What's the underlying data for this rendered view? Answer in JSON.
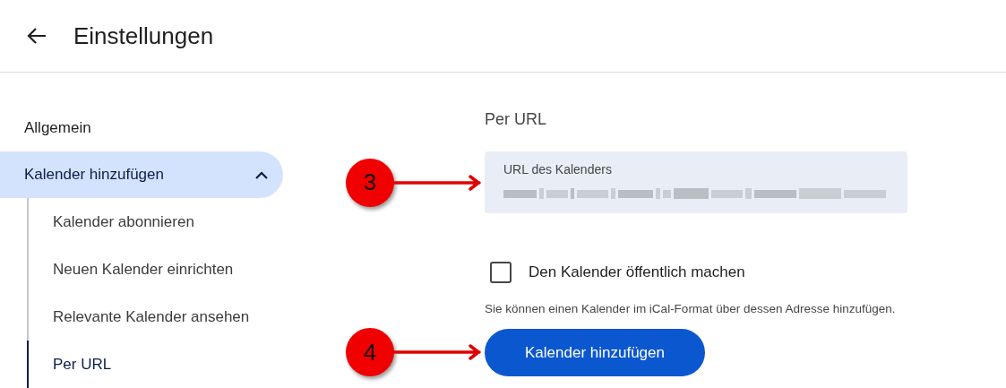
{
  "header": {
    "title": "Einstellungen"
  },
  "sidebar": {
    "items": [
      {
        "label": "Allgemein",
        "selected": false
      },
      {
        "label": "Kalender hinzufügen",
        "selected": true,
        "expanded": true,
        "children": [
          {
            "label": "Kalender abonnieren",
            "selected": false
          },
          {
            "label": "Neuen Kalender einrichten",
            "selected": false
          },
          {
            "label": "Relevante Kalender ansehen",
            "selected": false
          },
          {
            "label": "Per URL",
            "selected": true
          }
        ]
      }
    ]
  },
  "section": {
    "title": "Per URL",
    "url_field": {
      "label": "URL des Kalenders",
      "value_redacted": true
    },
    "checkbox": {
      "label": "Den Kalender öffentlich machen",
      "checked": false
    },
    "helper_text": "Sie können einen Kalender im iCal-Format über dessen Adresse hinzufügen.",
    "button": "Kalender hinzufügen"
  },
  "callouts": [
    {
      "label": "3"
    },
    {
      "label": "4"
    }
  ]
}
